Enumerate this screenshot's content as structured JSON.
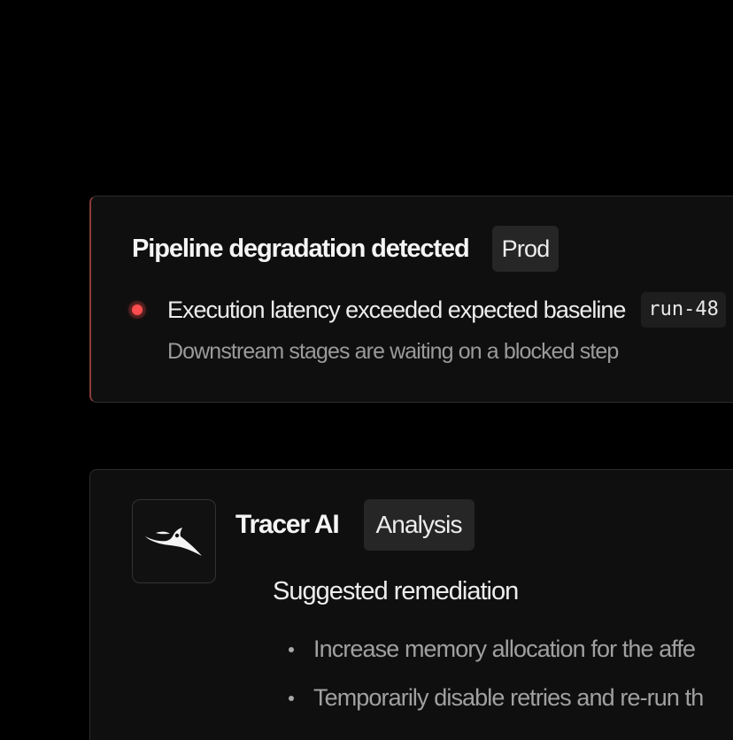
{
  "alert": {
    "title": "Pipeline degradation detected",
    "environment_tag": "Prod",
    "message": "Execution latency exceeded expected baseline",
    "run_id": "run-48",
    "detail": "Downstream stages are waiting on a blocked step",
    "status_color": "#ff4d4d",
    "status_icon": "status-dot-icon"
  },
  "ai": {
    "name": "Tracer AI",
    "tag": "Analysis",
    "logo_icon": "tracer-bird-logo-icon",
    "section_title": "Suggested remediation",
    "suggestions": [
      "Increase memory allocation for the affe",
      "Temporarily disable retries and re-run th"
    ]
  }
}
